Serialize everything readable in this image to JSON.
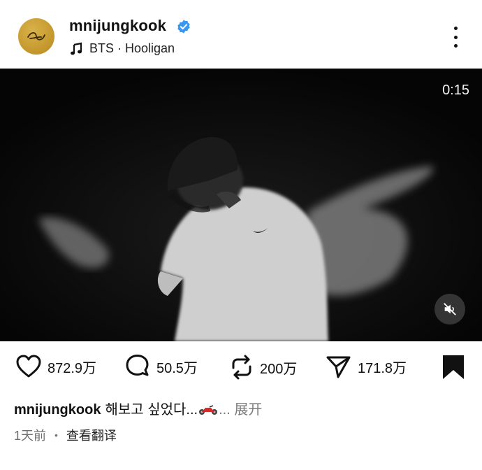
{
  "post": {
    "username": "mnijungkook",
    "verified": true,
    "music": "BTS · Hooligan"
  },
  "video": {
    "timer": "0:15",
    "muted": true
  },
  "actions": {
    "likes": "872.9万",
    "comments": "50.5万",
    "reposts": "200万",
    "shares": "171.8万"
  },
  "caption": {
    "username": "mnijungkook",
    "text": "해보고 싶었다...",
    "emoji": "motorcycle",
    "more": "... 展开"
  },
  "meta": {
    "time": "1天前",
    "separator": "•",
    "translate": "查看翻译"
  },
  "colors": {
    "verified_badge": "#3897f0",
    "avatar": "#c9a032",
    "video_bg": "#070707"
  }
}
